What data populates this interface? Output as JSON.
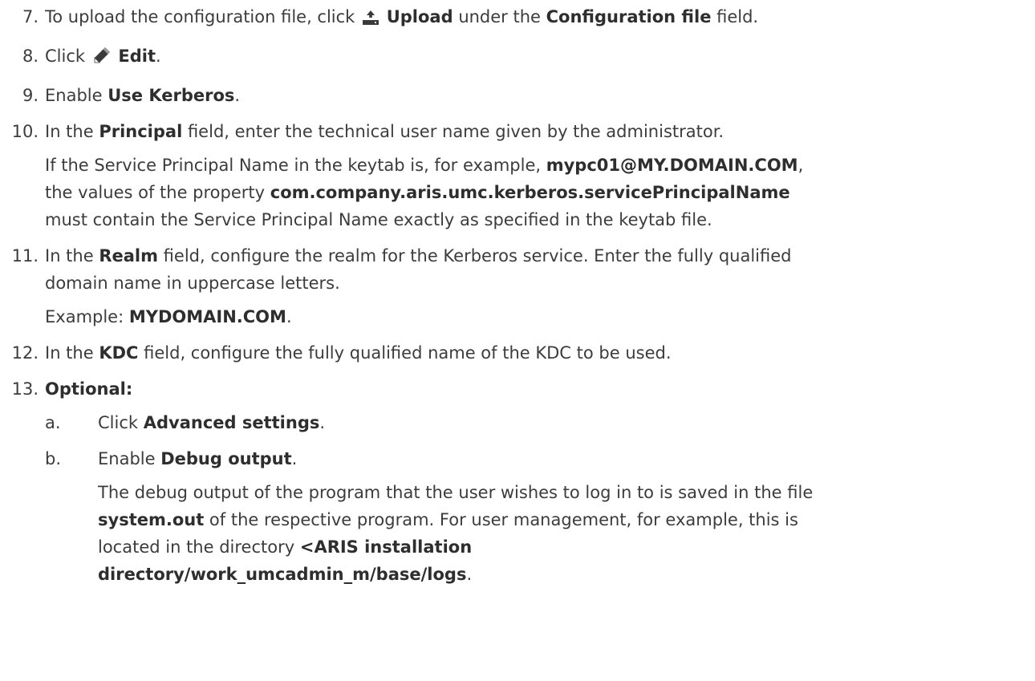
{
  "steps": [
    {
      "num": "7.",
      "parts": [
        "To upload the configuration file, click ",
        "Upload",
        " under the ",
        "Configuration file",
        " field."
      ],
      "icon": "upload-icon"
    },
    {
      "num": "8.",
      "parts": [
        "Click ",
        "Edit",
        "."
      ],
      "icon": "pencil-icon"
    },
    {
      "num": "9.",
      "parts": [
        "Enable ",
        "Use Kerberos",
        "."
      ]
    },
    {
      "num": "10.",
      "parts": [
        "In the ",
        "Principal",
        " field, enter the technical user name given by the administrator."
      ],
      "sub": [
        "If the Service Principal Name in the keytab is, for example, ",
        "mypc01@MY.DOMAIN.COM",
        ",",
        "the values of the property ",
        "com.company.aris.umc.kerberos.servicePrincipalName",
        "must contain the Service Principal Name exactly as specified in the keytab file."
      ]
    },
    {
      "num": "11.",
      "parts": [
        "In the ",
        "Realm",
        " field, configure the realm for the Kerberos service. Enter the fully qualified",
        "domain name in uppercase letters."
      ],
      "sub": [
        "Example: ",
        "MYDOMAIN.COM",
        "."
      ]
    },
    {
      "num": "12.",
      "parts": [
        "In the ",
        "KDC",
        " field, configure the fully qualified name of the KDC to be used."
      ]
    },
    {
      "num": "13.",
      "parts": [
        "Optional:"
      ]
    }
  ],
  "substeps": [
    {
      "letter": "a.",
      "parts": [
        "Click ",
        "Advanced settings",
        "."
      ]
    },
    {
      "letter": "b.",
      "parts": [
        "Enable ",
        "Debug output",
        "."
      ],
      "sub": [
        "The debug output of the program that the user wishes to log in to is saved in the file",
        "system.out",
        " of the respective program. For user management, for example, this is",
        "located in the directory ",
        "<ARIS installation",
        "directory/work_umcadmin_m/base/logs",
        "."
      ]
    }
  ]
}
